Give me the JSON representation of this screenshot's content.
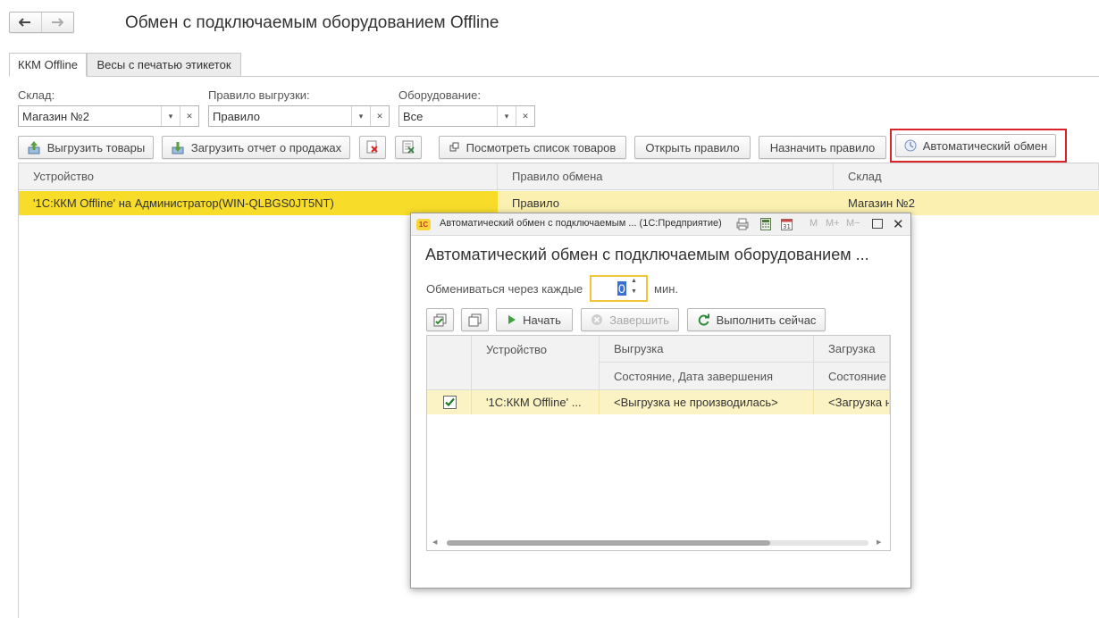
{
  "window": {
    "title": "Обмен с подключаемым оборудованием Offline"
  },
  "tabs": [
    {
      "label": "ККМ Offline",
      "active": true
    },
    {
      "label": "Весы с печатью этикеток",
      "active": false
    }
  ],
  "filters": {
    "warehouse": {
      "label": "Склад:",
      "value": "Магазин №2"
    },
    "rule": {
      "label": "Правило выгрузки:",
      "value": "Правило"
    },
    "equipment": {
      "label": "Оборудование:",
      "value": "Все"
    }
  },
  "toolbar": {
    "export_goods": "Выгрузить товары",
    "load_report": "Загрузить отчет о продажах",
    "view_goods": "Посмотреть список товаров",
    "open_rule": "Открыть правило",
    "assign_rule": "Назначить правило",
    "auto_exchange": "Автоматический обмен"
  },
  "grid": {
    "columns": [
      "Устройство",
      "Правило обмена",
      "Склад"
    ],
    "rows": [
      {
        "device": "'1С:ККМ Offline' на Администратор(WIN-QLBGS0JT5NT)",
        "rule": "Правило",
        "warehouse": "Магазин №2"
      }
    ]
  },
  "dialog": {
    "title_bar": "Автоматический обмен с подключаемым ...  (1С:Предприятие)",
    "logo": "1С",
    "heading": "Автоматический обмен с подключаемым оборудованием ...",
    "interval_label": "Обмениваться через каждые",
    "interval_value": "0",
    "interval_unit": "мин.",
    "buttons": {
      "start": "Начать",
      "finish": "Завершить",
      "run_now": "Выполнить сейчас"
    },
    "title_icons": {
      "m": "M",
      "m_plus": "M+",
      "m_minus": "M−"
    },
    "table": {
      "col_device": "Устройство",
      "col_export": "Выгрузка",
      "col_import": "Загрузка",
      "sub_export": "Состояние, Дата завершения",
      "sub_import": "Состояние ;",
      "rows": [
        {
          "checked": true,
          "device": "'1С:ККМ Offline' ...",
          "export_state": "<Выгрузка не производилась>",
          "import_state": "<Загрузка н"
        }
      ]
    }
  },
  "colors": {
    "selected_row": "#f8dc2a",
    "selected_row_light": "#fbf3c4",
    "highlight_box": "#d9242a",
    "input_focus": "#f0c53a",
    "start_icon": "#3aa63a"
  }
}
